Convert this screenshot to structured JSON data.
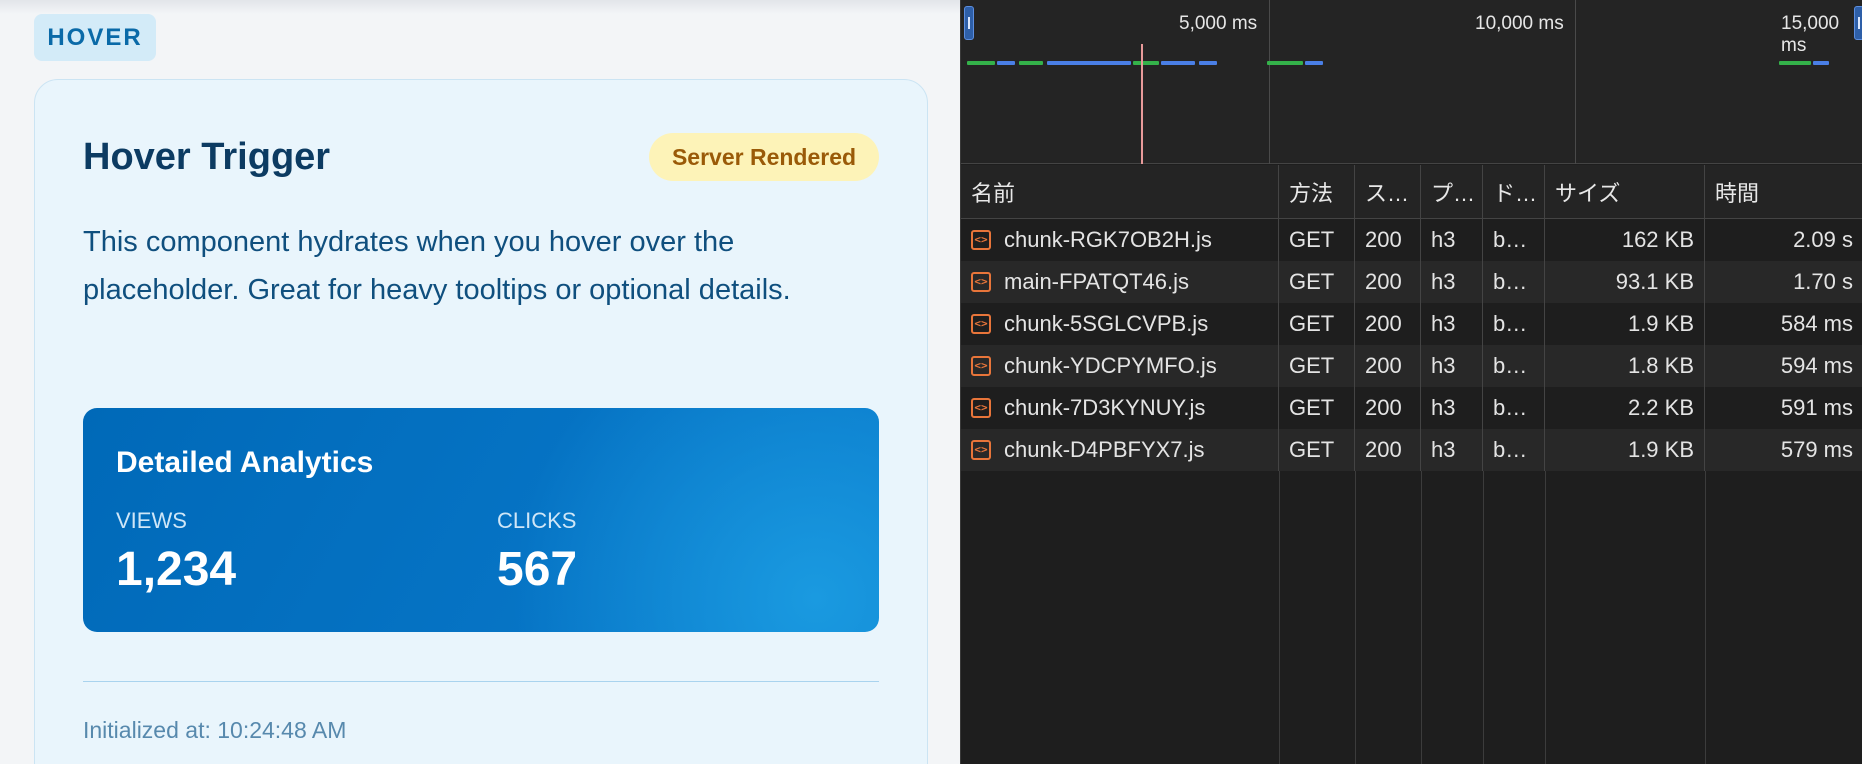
{
  "app": {
    "tag": "HOVER",
    "card": {
      "title": "Hover Trigger",
      "badge": "Server Rendered",
      "description": "This component hydrates when you hover over the placeholder. Great for heavy tooltips or optional details.",
      "analytics": {
        "title": "Detailed Analytics",
        "views_label": "VIEWS",
        "views_value": "1,234",
        "clicks_label": "CLICKS",
        "clicks_value": "567"
      },
      "initialized": "Initialized at: 10:24:48 AM"
    }
  },
  "devtools": {
    "timeline": {
      "labels": [
        "5,000 ms",
        "10,000 ms",
        "15,000 ms"
      ]
    },
    "columns": {
      "name": "名前",
      "method": "方法",
      "status": "ス…",
      "protocol": "プ…",
      "domain": "ド…",
      "size": "サイズ",
      "time": "時間"
    },
    "requests": [
      {
        "name": "chunk-RGK7OB2H.js",
        "method": "GET",
        "status": "200",
        "protocol": "h3",
        "domain": "b…",
        "size": "162 KB",
        "time": "2.09 s"
      },
      {
        "name": "main-FPATQT46.js",
        "method": "GET",
        "status": "200",
        "protocol": "h3",
        "domain": "b…",
        "size": "93.1 KB",
        "time": "1.70 s"
      },
      {
        "name": "chunk-5SGLCVPB.js",
        "method": "GET",
        "status": "200",
        "protocol": "h3",
        "domain": "b…",
        "size": "1.9 KB",
        "time": "584 ms"
      },
      {
        "name": "chunk-YDCPYMFO.js",
        "method": "GET",
        "status": "200",
        "protocol": "h3",
        "domain": "b…",
        "size": "1.8 KB",
        "time": "594 ms"
      },
      {
        "name": "chunk-7D3KYNUY.js",
        "method": "GET",
        "status": "200",
        "protocol": "h3",
        "domain": "b…",
        "size": "2.2 KB",
        "time": "591 ms"
      },
      {
        "name": "chunk-D4PBFYX7.js",
        "method": "GET",
        "status": "200",
        "protocol": "h3",
        "domain": "b…",
        "size": "1.9 KB",
        "time": "579 ms"
      }
    ],
    "colors": {
      "segment_green": "#34b24a",
      "segment_blue": "#4a7fe6",
      "file_icon": "#e8753a"
    }
  }
}
